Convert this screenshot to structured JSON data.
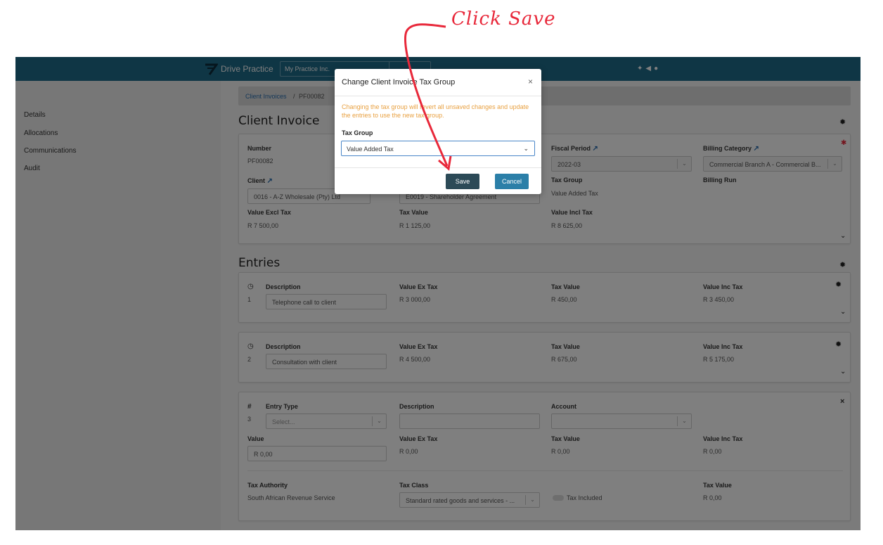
{
  "annotation": {
    "text": "Click Save",
    "color": "#e8283a"
  },
  "topbar": {
    "brand": "Drive Practice",
    "practice": "My Practice Inc.",
    "bg": "#1e6c8b"
  },
  "sidebar": {
    "items": [
      {
        "label": "Details"
      },
      {
        "label": "Allocations"
      },
      {
        "label": "Communications"
      },
      {
        "label": "Audit"
      }
    ]
  },
  "breadcrumb": {
    "parent": "Client Invoices",
    "sep": "/",
    "current": "PF00082"
  },
  "invoice": {
    "title": "Client Invoice",
    "number_label": "Number",
    "number": "PF00082",
    "client_label": "Client",
    "client": "0016 - A-Z Wholesale (Pty) Ltd",
    "engagement": "E0019 - Shareholder Agreement",
    "fiscal_label": "Fiscal Period",
    "fiscal": "2022-03",
    "billing_cat_label": "Billing Category",
    "billing_cat": "Commercial Branch A - Commercial B...",
    "tax_group_label": "Tax Group",
    "tax_group": "Value Added Tax",
    "billing_run_label": "Billing Run",
    "excl_label": "Value Excl Tax",
    "excl": "R 7 500,00",
    "tax_label": "Tax Value",
    "tax": "R 1 125,00",
    "incl_label": "Value Incl Tax",
    "incl": "R 8 625,00"
  },
  "entries": {
    "title": "Entries",
    "items": [
      {
        "num": "1",
        "desc_label": "Description",
        "desc": "Telephone call to client",
        "ex_label": "Value Ex Tax",
        "ex": "R 3 000,00",
        "tax_label": "Tax Value",
        "tax": "R 450,00",
        "inc_label": "Value Inc Tax",
        "inc": "R 3 450,00"
      },
      {
        "num": "2",
        "desc_label": "Description",
        "desc": "Consultation with client",
        "ex_label": "Value Ex Tax",
        "ex": "R 4 500,00",
        "tax_label": "Tax Value",
        "tax": "R 675,00",
        "inc_label": "Value Inc Tax",
        "inc": "R 5 175,00"
      }
    ],
    "new": {
      "hash": "#",
      "num": "3",
      "type_label": "Entry Type",
      "type_placeholder": "Select...",
      "desc_label": "Description",
      "account_label": "Account",
      "value_label": "Value",
      "value": "R 0,00",
      "ex_label": "Value Ex Tax",
      "ex": "R 0,00",
      "tax_label": "Tax Value",
      "tax": "R 0,00",
      "inc_label": "Value Inc Tax",
      "inc": "R 0,00",
      "authority_label": "Tax Authority",
      "authority": "South African Revenue Service",
      "class_label": "Tax Class",
      "class": "Standard rated goods and services - ...",
      "included_label": "Tax Included",
      "taxval_label": "Tax Value",
      "taxval": "R 0,00"
    }
  },
  "modal": {
    "title": "Change Client Invoice Tax Group",
    "close": "×",
    "warning": "Changing the tax group will revert all unsaved changes and update the entries to use the new tax group.",
    "field_label": "Tax Group",
    "field_value": "Value Added Tax",
    "save": "Save",
    "cancel": "Cancel"
  }
}
